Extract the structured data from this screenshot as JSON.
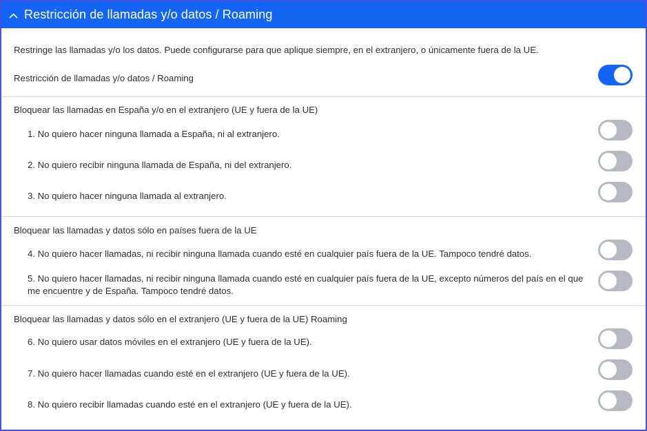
{
  "header": {
    "title": "Restricción de llamadas y/o datos / Roaming"
  },
  "description": "Restringe las llamadas y/o los datos. Puede configurarse para que aplique siempre, en el extranjero, o únicamente fuera de la UE.",
  "master": {
    "label": "Restricción de llamadas y/o datos / Roaming",
    "enabled": true
  },
  "sections": [
    {
      "title": "Bloquear las llamadas en España y/o en el extranjero (UE y fuera de la UE)",
      "options": [
        {
          "label": "1. No quiero hacer ninguna llamada a España, ni al extranjero.",
          "enabled": false
        },
        {
          "label": "2. No quiero recibir ninguna llamada de España, ni del extranjero.",
          "enabled": false
        },
        {
          "label": "3. No quiero hacer ninguna llamada al extranjero.",
          "enabled": false
        }
      ]
    },
    {
      "title": "Bloquear las llamadas y datos sólo en países fuera de la UE",
      "options": [
        {
          "label": "4. No quiero hacer llamadas, ni recibir ninguna llamada cuando esté en cualquier país fuera de la UE. Tampoco tendré datos.",
          "enabled": false
        },
        {
          "label_line1": "5. No quiero hacer llamadas, ni recibir ninguna llamada cuando esté en cualquier país fuera de la UE, excepto números del país en el que",
          "label_line2": "me encuentre y de España. Tampoco tendré datos.",
          "enabled": false
        }
      ]
    },
    {
      "title": "Bloquear las llamadas y datos sólo en el extranjero (UE y fuera de la UE) Roaming",
      "options": [
        {
          "label": "6. No quiero usar datos móviles en el extranjero (UE y fuera de la UE).",
          "enabled": false
        },
        {
          "label": "7. No quiero hacer llamadas cuando esté en el extranjero (UE y fuera de la UE).",
          "enabled": false
        },
        {
          "label": "8. No quiero recibir llamadas cuando esté en el extranjero (UE y fuera de la UE).",
          "enabled": false
        }
      ]
    }
  ],
  "colors": {
    "accent": "#1565f5",
    "border": "#4a4fe6",
    "toggle_off": "#b6b9c4",
    "text": "#2e2e2e"
  },
  "icons": {
    "collapse": "chevron-up-icon"
  }
}
